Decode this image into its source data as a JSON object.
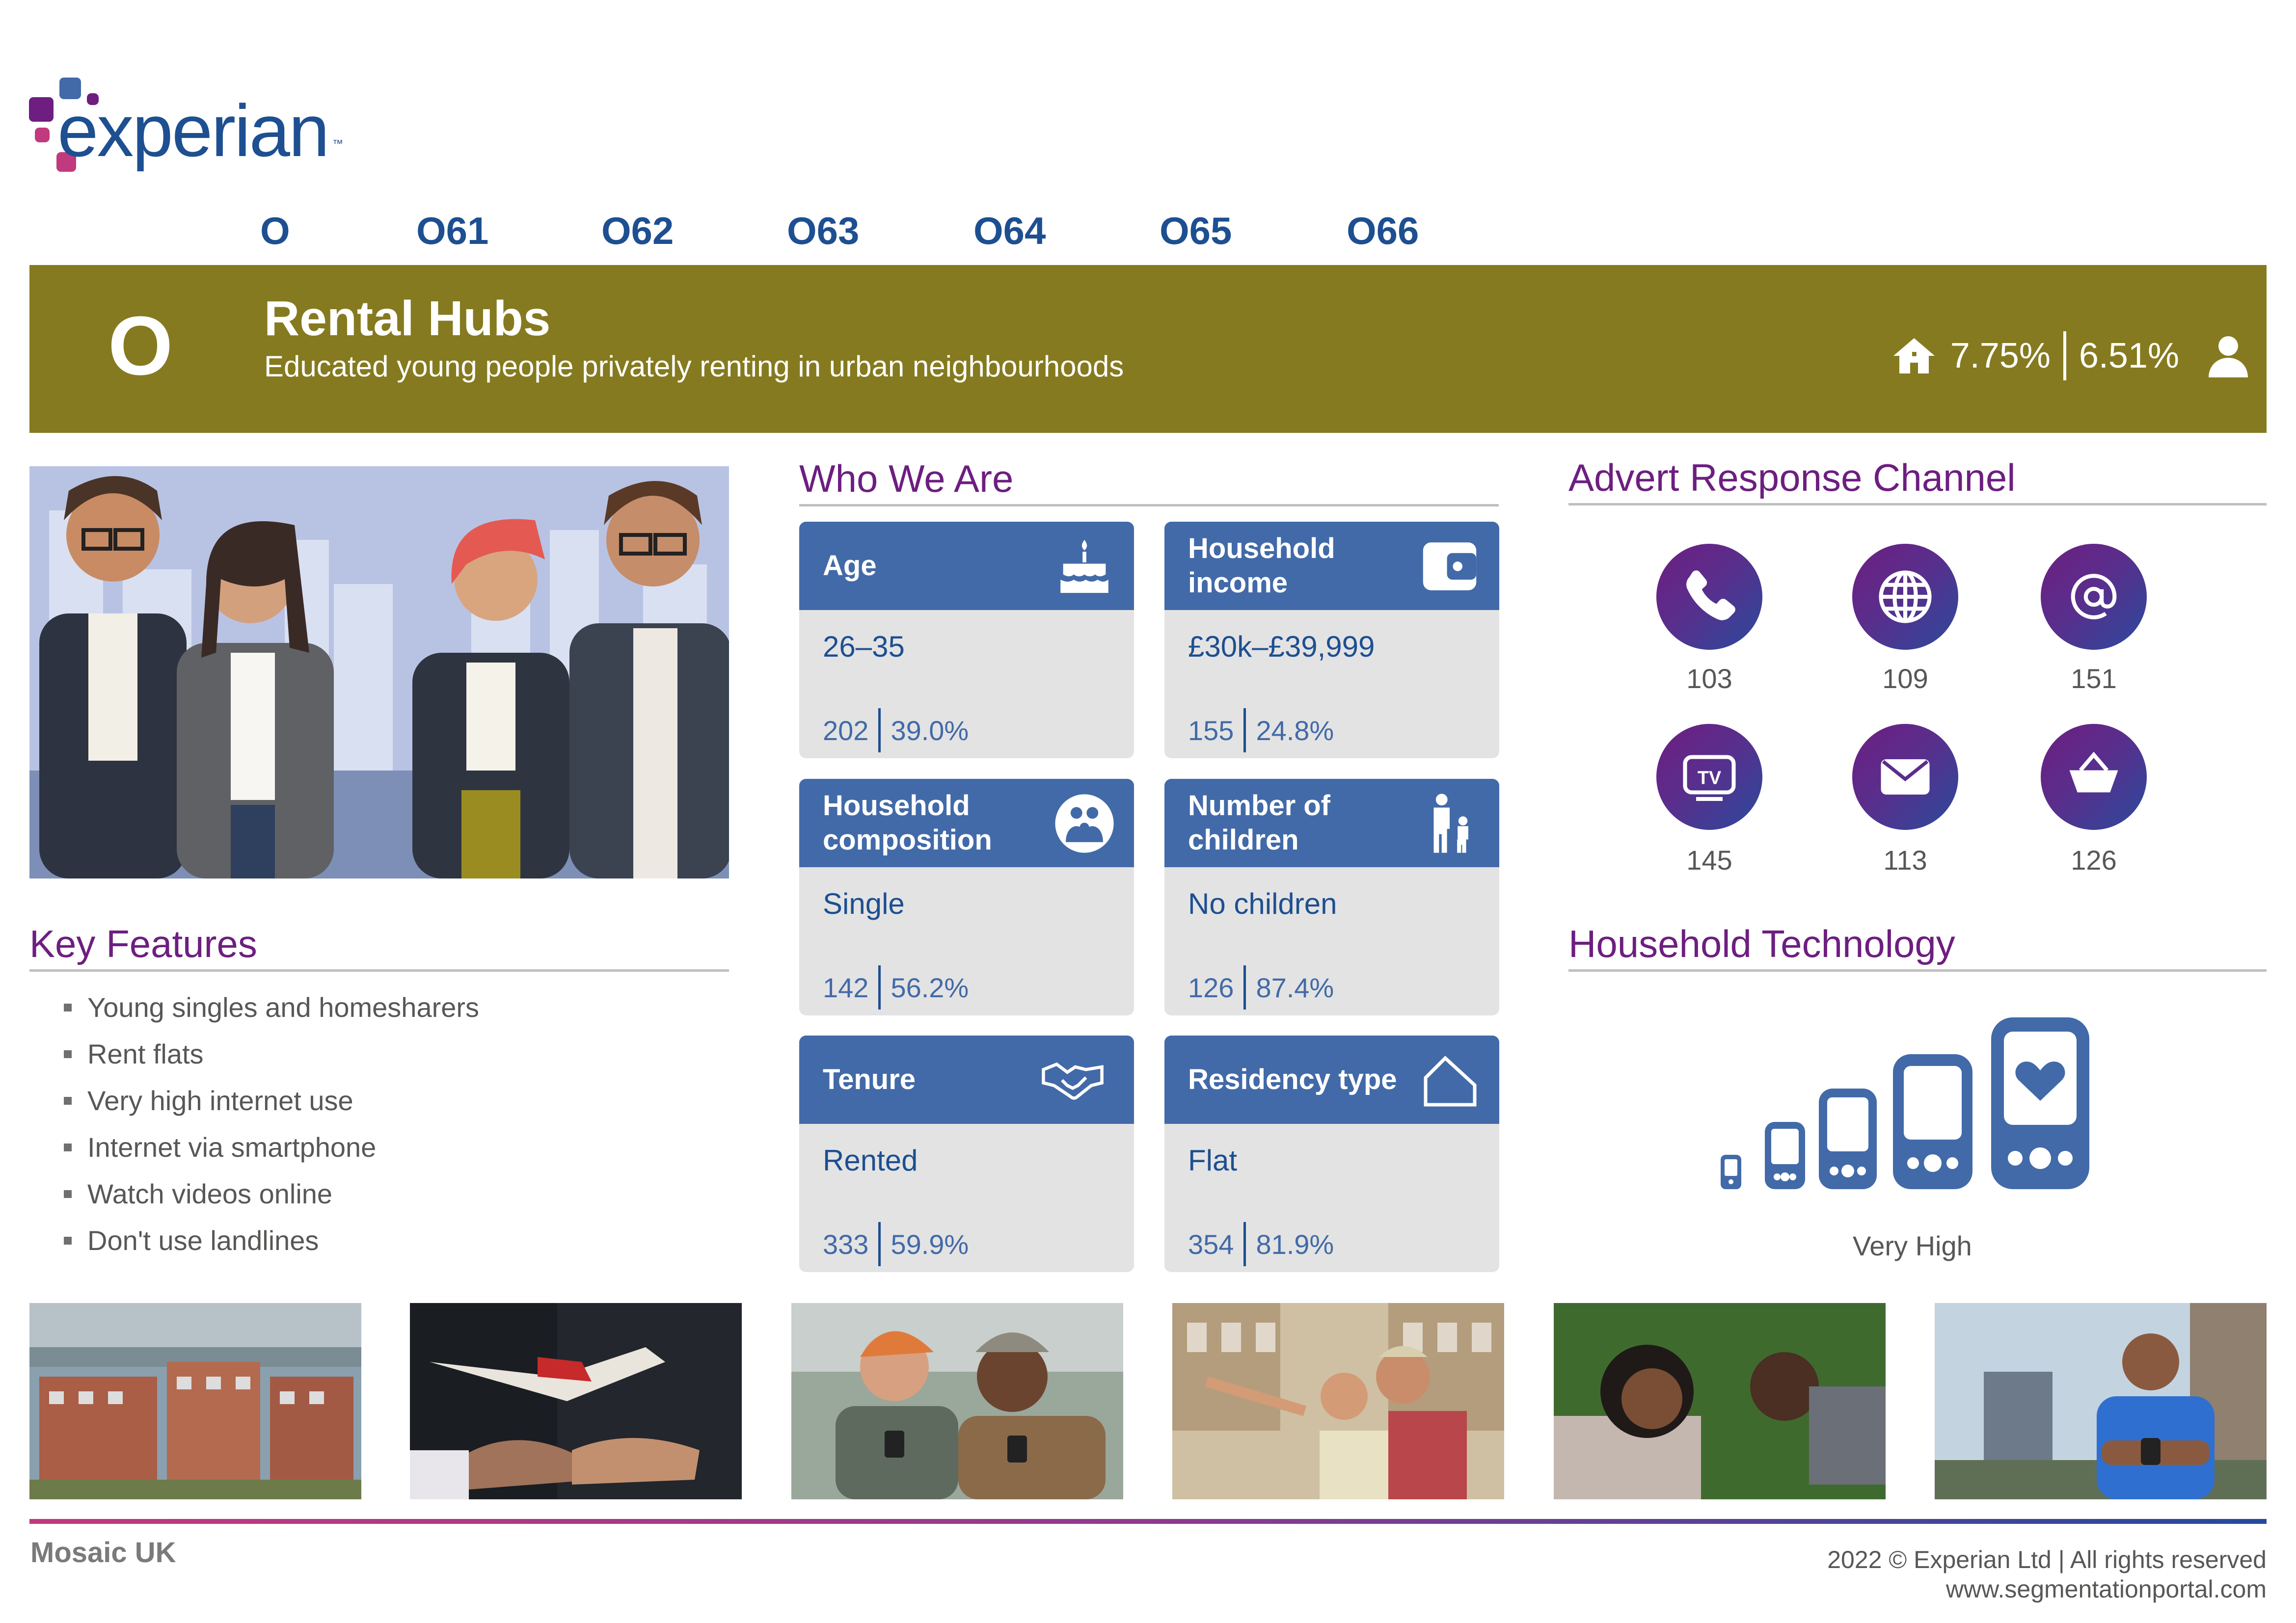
{
  "brand": {
    "name": "experian",
    "tm": "™"
  },
  "nav": {
    "codes": [
      "O",
      "O61",
      "O62",
      "O63",
      "O64",
      "O65",
      "O66"
    ]
  },
  "banner": {
    "letter": "O",
    "title": "Rental Hubs",
    "subtitle": "Educated young people privately renting in urban neighbourhoods",
    "households_pct": "7.75%",
    "population_pct": "6.51%",
    "icons": [
      "home-icon",
      "person-icon"
    ],
    "color": "#857a1f"
  },
  "key_features": {
    "title": "Key Features",
    "items": [
      "Young singles and homesharers",
      "Rent flats",
      "Very high internet use",
      "Internet via smartphone",
      "Watch videos online",
      "Don't use landlines"
    ]
  },
  "who_we_are": {
    "title": "Who We Are",
    "cards": [
      {
        "label": "Age",
        "icon": "birthday-cake-icon",
        "value": "26–35",
        "index": "202",
        "pct": "39.0%"
      },
      {
        "label": "Household income",
        "icon": "wallet-icon",
        "value": "£30k–£39,999",
        "index": "155",
        "pct": "24.8%"
      },
      {
        "label": "Household composition",
        "icon": "household-composition-icon",
        "value": "Single",
        "index": "142",
        "pct": "56.2%"
      },
      {
        "label": "Number of children",
        "icon": "adult-child-icon",
        "value": "No children",
        "index": "126",
        "pct": "87.4%"
      },
      {
        "label": "Tenure",
        "icon": "handshake-icon",
        "value": "Rented",
        "index": "333",
        "pct": "59.9%"
      },
      {
        "label": "Residency type",
        "icon": "house-outline-icon",
        "value": "Flat",
        "index": "354",
        "pct": "81.9%"
      }
    ]
  },
  "advert_channel": {
    "title": "Advert Response Channel",
    "channels": [
      {
        "icon": "phone-icon",
        "value": "103"
      },
      {
        "icon": "globe-icon",
        "value": "109"
      },
      {
        "icon": "email-at-icon",
        "value": "151"
      },
      {
        "icon": "tv-icon",
        "value": "145"
      },
      {
        "icon": "mail-envelope-icon",
        "value": "113"
      },
      {
        "icon": "shopping-basket-icon",
        "value": "126"
      }
    ]
  },
  "household_technology": {
    "title": "Household Technology",
    "level": "Very High",
    "icon": "devices-icon"
  },
  "photos": [
    "flats-photo",
    "handshake-photo",
    "smartphone-friends-photo",
    "tourists-map-photo",
    "couple-lying-grass-photo",
    "man-smartwatch-photo"
  ],
  "footer": {
    "left": "Mosaic UK",
    "copyright": "2022 © Experian Ltd | All rights reserved",
    "website": "www.segmentationportal.com"
  },
  "colors": {
    "navy": "#1d4f91",
    "purple": "#6d1e80",
    "card_blue": "#426aa8",
    "banner": "#857a1f"
  }
}
